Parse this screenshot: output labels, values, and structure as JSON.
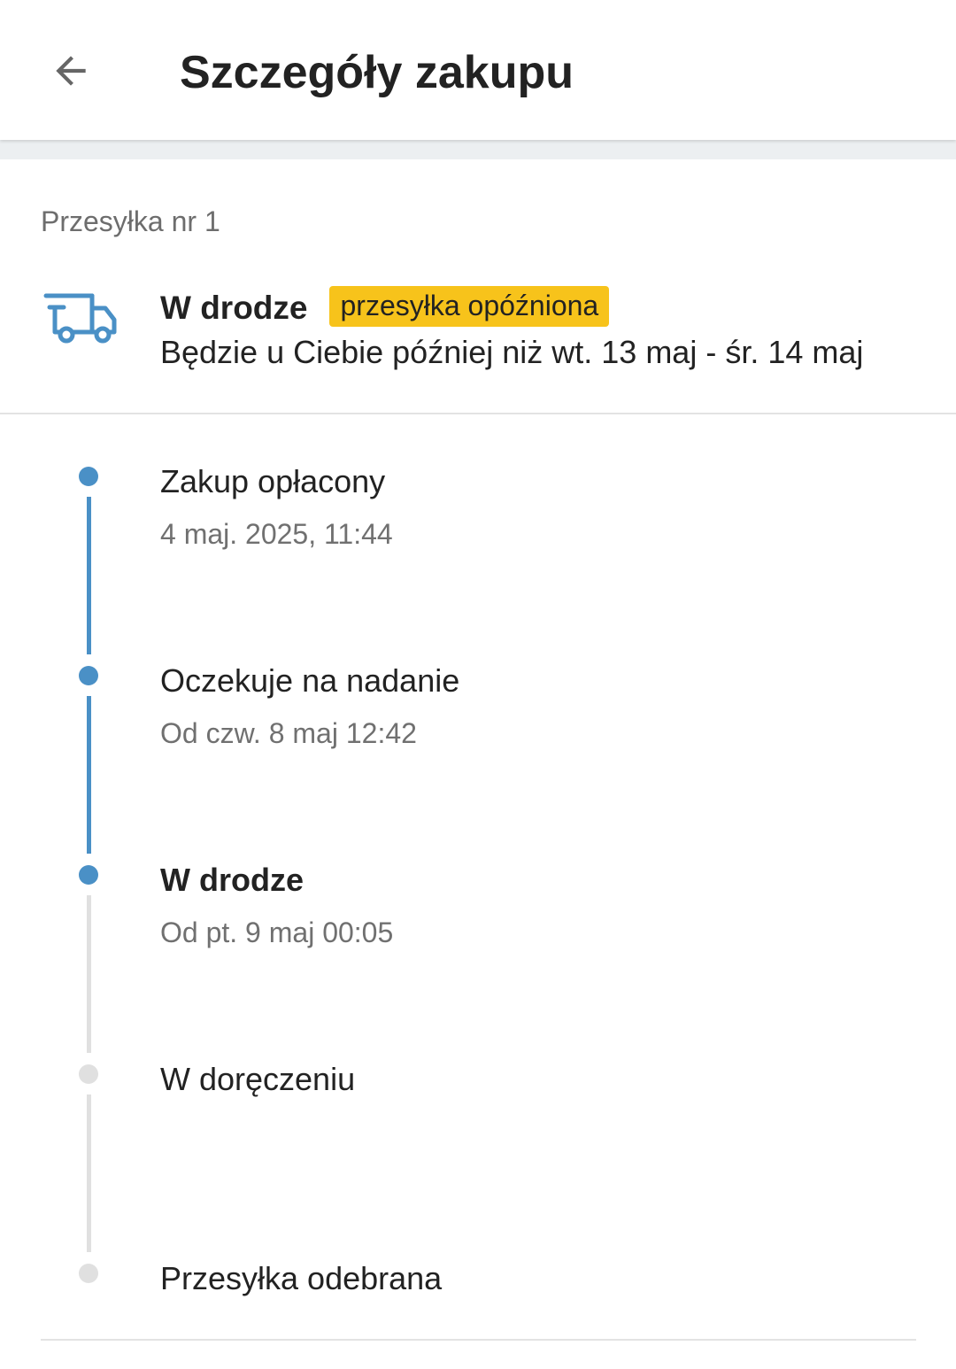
{
  "header": {
    "title": "Szczegóły zakupu",
    "back_icon": "arrow-left-icon"
  },
  "shipment": {
    "number_label": "Przesyłka nr 1",
    "icon": "truck-icon",
    "icon_color": "#4a90c6",
    "status": "W drodze",
    "badge": "przesyłka opóźniona",
    "badge_color": "#f7c31b",
    "eta": "Będzie u Ciebie później niż wt. 13 maj - śr. 14 maj"
  },
  "timeline": {
    "active_color": "#4a90c6",
    "inactive_color": "#e0e0e0",
    "steps": [
      {
        "label": "Zakup opłacony",
        "date": "4 maj. 2025, 11:44",
        "done": true,
        "current": false
      },
      {
        "label": "Oczekuje na nadanie",
        "date": "Od czw. 8 maj 12:42",
        "done": true,
        "current": false
      },
      {
        "label": "W drodze",
        "date": "Od pt. 9 maj 00:05",
        "done": true,
        "current": true
      },
      {
        "label": "W doręczeniu",
        "date": "",
        "done": false,
        "current": false
      },
      {
        "label": "Przesyłka odebrana",
        "date": "",
        "done": false,
        "current": false
      }
    ]
  }
}
